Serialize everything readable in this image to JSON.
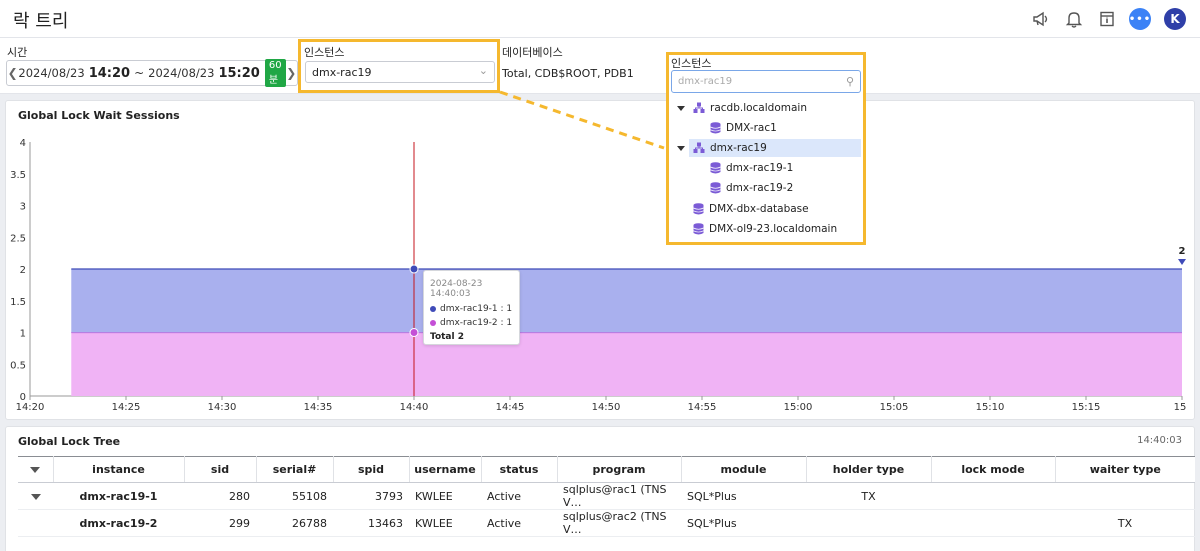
{
  "header": {
    "title": "락 트리"
  },
  "icons": {
    "announce": "megaphone-icon",
    "notify": "bell-icon",
    "docs": "document-icon",
    "chat": "chat-icon",
    "avatar_letter": "K"
  },
  "filters": {
    "time_label": "시간",
    "start_date": "2024/08/23",
    "start_time": "14:20",
    "sep": "~",
    "end_date": "2024/08/23",
    "end_time": "15:20",
    "range_badge": "60분",
    "instance_label": "인스턴스",
    "instance_value": "dmx-rac19",
    "database_label": "데이터베이스",
    "database_value": "Total, CDB$ROOT, PDB1"
  },
  "instance_dropdown": {
    "label": "인스턴스",
    "search_placeholder": "dmx-rac19",
    "nodes": [
      {
        "label": "racdb.localdomain",
        "kind": "cluster",
        "expanded": true,
        "level": 0
      },
      {
        "label": "DMX-rac1",
        "kind": "db",
        "level": 1
      },
      {
        "label": "dmx-rac19",
        "kind": "cluster",
        "expanded": true,
        "level": 0,
        "selected": true
      },
      {
        "label": "dmx-rac19-1",
        "kind": "db",
        "level": 1
      },
      {
        "label": "dmx-rac19-2",
        "kind": "db",
        "level": 1
      },
      {
        "label": "DMX-dbx-database",
        "kind": "db",
        "level": 0
      },
      {
        "label": "DMX-ol9-23.localdomain",
        "kind": "db",
        "level": 0
      }
    ]
  },
  "chart_panel": {
    "title": "Global Lock Wait Sessions"
  },
  "chart_data": {
    "type": "area",
    "x": [
      "14:20",
      "14:25",
      "14:30",
      "14:35",
      "14:40",
      "14:45",
      "14:50",
      "14:55",
      "15:00",
      "15:05",
      "15:10",
      "15:15",
      "15"
    ],
    "ylim": [
      0,
      4
    ],
    "yticks": [
      "0",
      "0.5",
      "1",
      "1.5",
      "2",
      "2.5",
      "3",
      "3.5",
      "4"
    ],
    "stacked": true,
    "series": [
      {
        "name": "dmx-rac19-2",
        "value": 1,
        "color": "#f0b3f5",
        "line": "#c44fd6"
      },
      {
        "name": "dmx-rac19-1",
        "value": 1,
        "color": "#a9b0ee",
        "line": "#3f4bb8"
      }
    ],
    "last_value_label": "2",
    "cursor_time": "14:40",
    "cursor_color": "#c4161c"
  },
  "tooltip": {
    "time": "2024-08-23 14:40:03",
    "rows": [
      {
        "label": "dmx-rac19-1 : 1",
        "color": "#3f4bb8"
      },
      {
        "label": "dmx-rac19-2 : 1",
        "color": "#c44fd6"
      }
    ],
    "total": "Total  2"
  },
  "tree_panel": {
    "title": "Global Lock Tree",
    "time": "14:40:03",
    "columns": [
      "instance",
      "sid",
      "serial#",
      "spid",
      "username",
      "status",
      "program",
      "module",
      "holder type",
      "lock mode",
      "waiter type"
    ],
    "rows": [
      {
        "instance": "dmx-rac19-1",
        "sid": "280",
        "serial": "55108",
        "spid": "3793",
        "username": "KWLEE",
        "status": "Active",
        "program": "sqlplus@rac1 (TNS V…",
        "module": "SQL*Plus",
        "holder_type": "TX",
        "lock_mode": "",
        "waiter_type": ""
      },
      {
        "instance": "dmx-rac19-2",
        "sid": "299",
        "serial": "26788",
        "spid": "13463",
        "username": "KWLEE",
        "status": "Active",
        "program": "sqlplus@rac2 (TNS V…",
        "module": "SQL*Plus",
        "holder_type": "",
        "lock_mode": "",
        "waiter_type": "TX"
      }
    ]
  }
}
